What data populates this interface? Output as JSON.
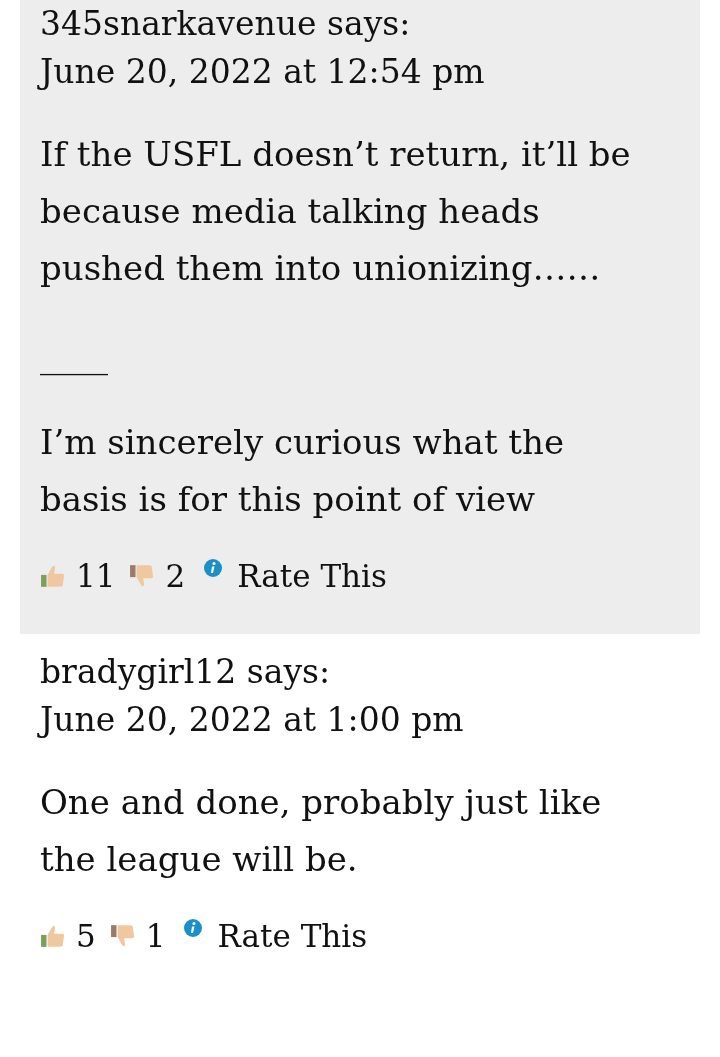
{
  "comments": [
    {
      "author": "345snarkavenue",
      "says": "says:",
      "date": "June 20, 2022 at 12:54 pm",
      "highlighted": true,
      "paragraphs": [
        "If the USFL doesn’t return, it’ll be because media talking heads pushed them into unionizing……",
        "____",
        "I’m sincerely curious what the basis is for this point of view"
      ],
      "likes": "11",
      "dislikes": "2",
      "rate": "Rate This"
    },
    {
      "author": "bradygirl12",
      "says": "says:",
      "date": "June 20, 2022 at 1:00 pm",
      "highlighted": false,
      "paragraphs": [
        "One and done, probably just like the league will be."
      ],
      "likes": "5",
      "dislikes": "1",
      "rate": "Rate This"
    }
  ]
}
